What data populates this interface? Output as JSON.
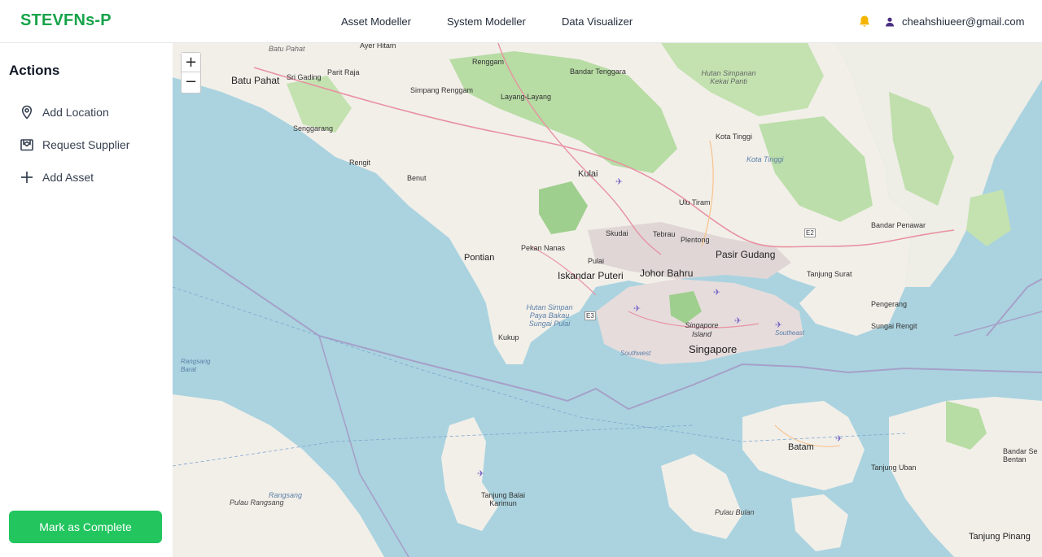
{
  "header": {
    "brand": "STEVFNs-P",
    "nav": [
      "Asset Modeller",
      "System Modeller",
      "Data Visualizer"
    ],
    "user_email": "cheahshiueer@gmail.com",
    "bell_icon": "bell-icon",
    "user_icon": "user-icon"
  },
  "sidebar": {
    "title": "Actions",
    "actions": [
      {
        "label": "Add Location",
        "icon": "location-pin-icon"
      },
      {
        "label": "Request Supplier",
        "icon": "supplier-request-icon"
      },
      {
        "label": "Add Asset",
        "icon": "plus-icon"
      }
    ],
    "complete_label": "Mark as Complete"
  },
  "colors": {
    "brand": "#16a34a",
    "button": "#22c55e",
    "bell": "#f5b400",
    "sea": "#aad3df",
    "land": "#f2efe9",
    "forest": "#b7dca4"
  },
  "map": {
    "zoom_in": "+",
    "zoom_out": "−",
    "labels": {
      "batu_pahat_top": "Batu Pahat",
      "ayer_hitam": "Ayer Hitam",
      "batu_pahat": "Batu Pahat",
      "parit_raja": "Parit Raja",
      "sri_gading": "Sri Gading",
      "renggam": "Renggam",
      "bandar_tenggara": "Bandar Tenggara",
      "hutan_simpanan_kekai_panti": "Hutan Simpanan Kekai Panti",
      "simpang_renggam": "Simpang Renggam",
      "layang_layang": "Layang-Layang",
      "senggarang": "Senggarang",
      "kota_tinggi": "Kota Tinggi",
      "kota_tinggi_river": "Kota Tinggi",
      "rengit": "Rengit",
      "benut": "Benut",
      "kulai": "Kulai",
      "ulu_tiram": "Ulu Tiram",
      "bandar_penawar": "Bandar Penawar",
      "skudai": "Skudai",
      "tebrau": "Tebrau",
      "plentong": "Plentong",
      "e2": "E2",
      "pekan_nanas": "Pekan Nanas",
      "pontian": "Pontian",
      "pulai": "Pulai",
      "pasir_gudang": "Pasir Gudang",
      "johor_bahru": "Johor Bahru",
      "iskandar_puteri": "Iskandar Puteri",
      "tanjung_surat": "Tanjung Surat",
      "hutan_simpan_paya_bakau_sungai_pulai": "Hutan Simpan Paya Bakau Sungai Pulai",
      "e3": "E3",
      "pengerang": "Pengerang",
      "sungai_rengit": "Sungai Rengit",
      "kukup": "Kukup",
      "singapore_island": "Singapore Island",
      "singapore": "Singapore",
      "southeast": "Southeast",
      "southwest": "Southwest",
      "rangsang_barat": "Rangsang Barat",
      "batam": "Batam",
      "tanjung_uban": "Tanjung Uban",
      "bandar_seri_bentan": "Bandar Se Bentan",
      "tanjung_balai_karimun": "Tanjung Balai Karimun",
      "rangsang": "Rangsang",
      "pulau_rangsang": "Pulau Rangsang",
      "pulau_bulan": "Pulau Bulan",
      "tanjung_pinang": "Tanjung Pinang"
    }
  }
}
